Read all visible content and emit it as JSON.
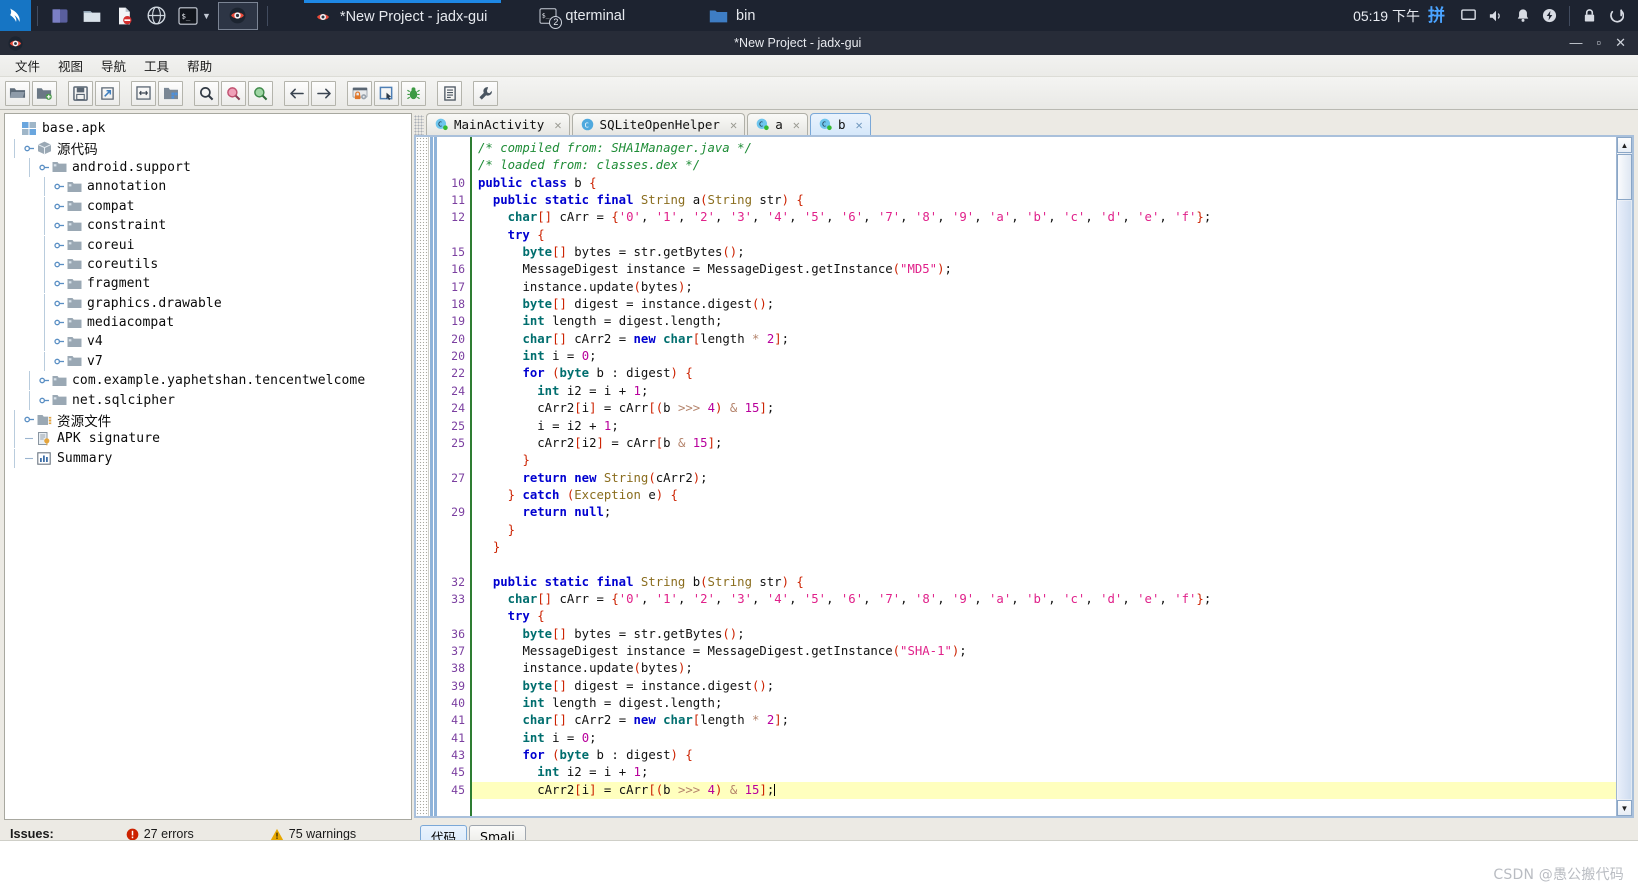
{
  "taskbar": {
    "clock": "05:19 下午",
    "ime": "拼",
    "launchers": [
      {
        "name": "kali-menu-icon"
      },
      {
        "name": "files-manager-icon"
      },
      {
        "name": "file-manager-icon"
      },
      {
        "name": "document-icon"
      },
      {
        "name": "web-browser-icon"
      },
      {
        "name": "terminal-icon"
      },
      {
        "name": "chevron-down-icon"
      },
      {
        "name": "jadx-launcher-icon"
      }
    ],
    "windows": [
      {
        "label": "*New Project - jadx-gui",
        "icon": "jadx-icon",
        "active": true
      },
      {
        "label": "qterminal",
        "icon": "terminal-icon",
        "badge": "2",
        "active": false
      },
      {
        "label": "bin",
        "icon": "folder-icon",
        "active": false
      }
    ],
    "tray": [
      "display-icon",
      "volume-icon",
      "bell-icon",
      "power-icon",
      "lock-icon",
      "logout-icon"
    ]
  },
  "window": {
    "title": "*New Project - jadx-gui",
    "minimize": "—",
    "maximize": "▫",
    "close": "✕"
  },
  "menubar": {
    "items": [
      "文件",
      "视图",
      "导航",
      "工具",
      "帮助"
    ]
  },
  "toolbar": {
    "buttons": [
      {
        "name": "open-file-button",
        "icon": "folder-open-icon"
      },
      {
        "name": "add-files-button",
        "icon": "folder-add-icon"
      },
      {
        "name": "save-all-button",
        "icon": "save-icon"
      },
      {
        "name": "export-gradle-button",
        "icon": "export-icon"
      },
      {
        "name": "sync-button",
        "icon": "collapse-icon"
      },
      {
        "name": "deobfuscation-button",
        "icon": "blocks-icon"
      },
      {
        "name": "search-text-button",
        "icon": "search-icon"
      },
      {
        "name": "search-class-button",
        "icon": "search-red-icon"
      },
      {
        "name": "search-comment-button",
        "icon": "search-green-icon"
      },
      {
        "name": "back-button",
        "icon": "arrow-left-icon"
      },
      {
        "name": "forward-button",
        "icon": "arrow-right-icon"
      },
      {
        "name": "decompile-settings-button",
        "icon": "lock-gear-icon"
      },
      {
        "name": "select-class-button",
        "icon": "select-icon"
      },
      {
        "name": "debugger-button",
        "icon": "bug-icon"
      },
      {
        "name": "log-viewer-button",
        "icon": "log-icon"
      },
      {
        "name": "preferences-button",
        "icon": "wrench-icon"
      }
    ]
  },
  "tree": {
    "nodes": [
      {
        "label": "base.apk",
        "depth": 0,
        "icon": "apk-icon",
        "handle": "none"
      },
      {
        "label": "源代码",
        "depth": 1,
        "icon": "package-icon",
        "handle": "expanded",
        "cjk": true
      },
      {
        "label": "android.support",
        "depth": 2,
        "icon": "folder-icon",
        "handle": "expanded"
      },
      {
        "label": "annotation",
        "depth": 3,
        "icon": "folder-icon",
        "handle": "collapsed"
      },
      {
        "label": "compat",
        "depth": 3,
        "icon": "folder-icon",
        "handle": "collapsed"
      },
      {
        "label": "constraint",
        "depth": 3,
        "icon": "folder-icon",
        "handle": "collapsed"
      },
      {
        "label": "coreui",
        "depth": 3,
        "icon": "folder-icon",
        "handle": "collapsed"
      },
      {
        "label": "coreutils",
        "depth": 3,
        "icon": "folder-icon",
        "handle": "collapsed"
      },
      {
        "label": "fragment",
        "depth": 3,
        "icon": "folder-icon",
        "handle": "collapsed"
      },
      {
        "label": "graphics.drawable",
        "depth": 3,
        "icon": "folder-icon",
        "handle": "collapsed"
      },
      {
        "label": "mediacompat",
        "depth": 3,
        "icon": "folder-icon",
        "handle": "collapsed"
      },
      {
        "label": "v4",
        "depth": 3,
        "icon": "folder-icon",
        "handle": "collapsed"
      },
      {
        "label": "v7",
        "depth": 3,
        "icon": "folder-icon",
        "handle": "collapsed"
      },
      {
        "label": "com.example.yaphetshan.tencentwelcome",
        "depth": 2,
        "icon": "folder-icon",
        "handle": "collapsed"
      },
      {
        "label": "net.sqlcipher",
        "depth": 2,
        "icon": "folder-icon",
        "handle": "collapsed"
      },
      {
        "label": "资源文件",
        "depth": 1,
        "icon": "resource-icon",
        "handle": "collapsed",
        "cjk": true
      },
      {
        "label": "APK signature",
        "depth": 1,
        "icon": "signature-icon",
        "handle": "leaf"
      },
      {
        "label": "Summary",
        "depth": 1,
        "icon": "summary-icon",
        "handle": "leaf"
      }
    ]
  },
  "status": {
    "label": "Issues:",
    "errors": "27 errors",
    "warnings": "75 warnings",
    "error_color": "#cc2200",
    "warning_color": "#e8a800"
  },
  "editor": {
    "tabs": [
      {
        "label": "MainActivity",
        "icon": "class-icon",
        "active": false,
        "close": "✕"
      },
      {
        "label": "SQLiteOpenHelper",
        "icon": "interface-icon",
        "active": false,
        "close": "✕"
      },
      {
        "label": "a",
        "icon": "class-icon",
        "active": false,
        "close": "✕"
      },
      {
        "label": "b",
        "icon": "class-icon",
        "active": true,
        "close": "✕"
      }
    ],
    "bottom_tabs": [
      {
        "label": "代码",
        "active": true
      },
      {
        "label": "Smali",
        "active": false
      }
    ],
    "line_numbers": [
      "",
      "",
      "10",
      "11",
      "12",
      "",
      "15",
      "16",
      "17",
      "18",
      "19",
      "20",
      "20",
      "22",
      "24",
      "24",
      "25",
      "25",
      "",
      "27",
      "",
      "29",
      "",
      "",
      "",
      "32",
      "33",
      "",
      "36",
      "37",
      "38",
      "39",
      "40",
      "41",
      "41",
      "43",
      "45",
      "45"
    ],
    "code_lines": [
      {
        "t": "/* compiled from: SHA1Manager.java */",
        "k": "cmt"
      },
      {
        "t": "/* loaded from: classes.dex */",
        "k": "cmt"
      },
      {
        "t": "public class b {",
        "k": "l_class"
      },
      {
        "t": "  public static final String a(String str) {",
        "k": "l_method_a"
      },
      {
        "t": "    char[] cArr = {'0', '1', '2', '3', '4', '5', '6', '7', '8', '9', 'a', 'b', 'c', 'd', 'e', 'f'};",
        "k": "l_carr"
      },
      {
        "t": "    try {",
        "k": "l_try"
      },
      {
        "t": "      byte[] bytes = str.getBytes();",
        "k": "l_bytes"
      },
      {
        "t": "      MessageDigest instance = MessageDigest.getInstance(\"MD5\");",
        "k": "l_md",
        "arg": "MD5"
      },
      {
        "t": "      instance.update(bytes);",
        "k": "l_update"
      },
      {
        "t": "      byte[] digest = instance.digest();",
        "k": "l_digest"
      },
      {
        "t": "      int length = digest.length;",
        "k": "l_length"
      },
      {
        "t": "      char[] cArr2 = new char[length * 2];",
        "k": "l_carr2"
      },
      {
        "t": "      int i = 0;",
        "k": "l_i0"
      },
      {
        "t": "      for (byte b : digest) {",
        "k": "l_for"
      },
      {
        "t": "        int i2 = i + 1;",
        "k": "l_i2"
      },
      {
        "t": "        cArr2[i] = cArr[(b >>> 4) & 15];",
        "k": "l_assign1"
      },
      {
        "t": "        i = i2 + 1;",
        "k": "l_iassign"
      },
      {
        "t": "        cArr2[i2] = cArr[b & 15];",
        "k": "l_assign2"
      },
      {
        "t": "      }",
        "k": "l_brace"
      },
      {
        "t": "      return new String(cArr2);",
        "k": "l_return"
      },
      {
        "t": "    } catch (Exception e) {",
        "k": "l_catch"
      },
      {
        "t": "      return null;",
        "k": "l_retnull"
      },
      {
        "t": "    }",
        "k": "l_brace2"
      },
      {
        "t": "  }",
        "k": "l_brace3"
      },
      {
        "t": "",
        "k": "blank"
      },
      {
        "t": "  public static final String b(String str) {",
        "k": "l_method_b"
      },
      {
        "t": "    char[] cArr = {'0', '1', '2', '3', '4', '5', '6', '7', '8', '9', 'a', 'b', 'c', 'd', 'e', 'f'};",
        "k": "l_carr"
      },
      {
        "t": "    try {",
        "k": "l_try"
      },
      {
        "t": "      byte[] bytes = str.getBytes();",
        "k": "l_bytes"
      },
      {
        "t": "      MessageDigest instance = MessageDigest.getInstance(\"SHA-1\");",
        "k": "l_md",
        "arg": "SHA-1"
      },
      {
        "t": "      instance.update(bytes);",
        "k": "l_update"
      },
      {
        "t": "      byte[] digest = instance.digest();",
        "k": "l_digest"
      },
      {
        "t": "      int length = digest.length;",
        "k": "l_length"
      },
      {
        "t": "      char[] cArr2 = new char[length * 2];",
        "k": "l_carr2"
      },
      {
        "t": "      int i = 0;",
        "k": "l_i0"
      },
      {
        "t": "      for (byte b : digest) {",
        "k": "l_for"
      },
      {
        "t": "        int i2 = i + 1;",
        "k": "l_i2"
      },
      {
        "t": "        cArr2[i] = cArr[(b >>> 4) & 15];",
        "k": "l_assign1_hl"
      }
    ]
  },
  "watermark": {
    "text": "CSDN @愚公搬代码"
  }
}
